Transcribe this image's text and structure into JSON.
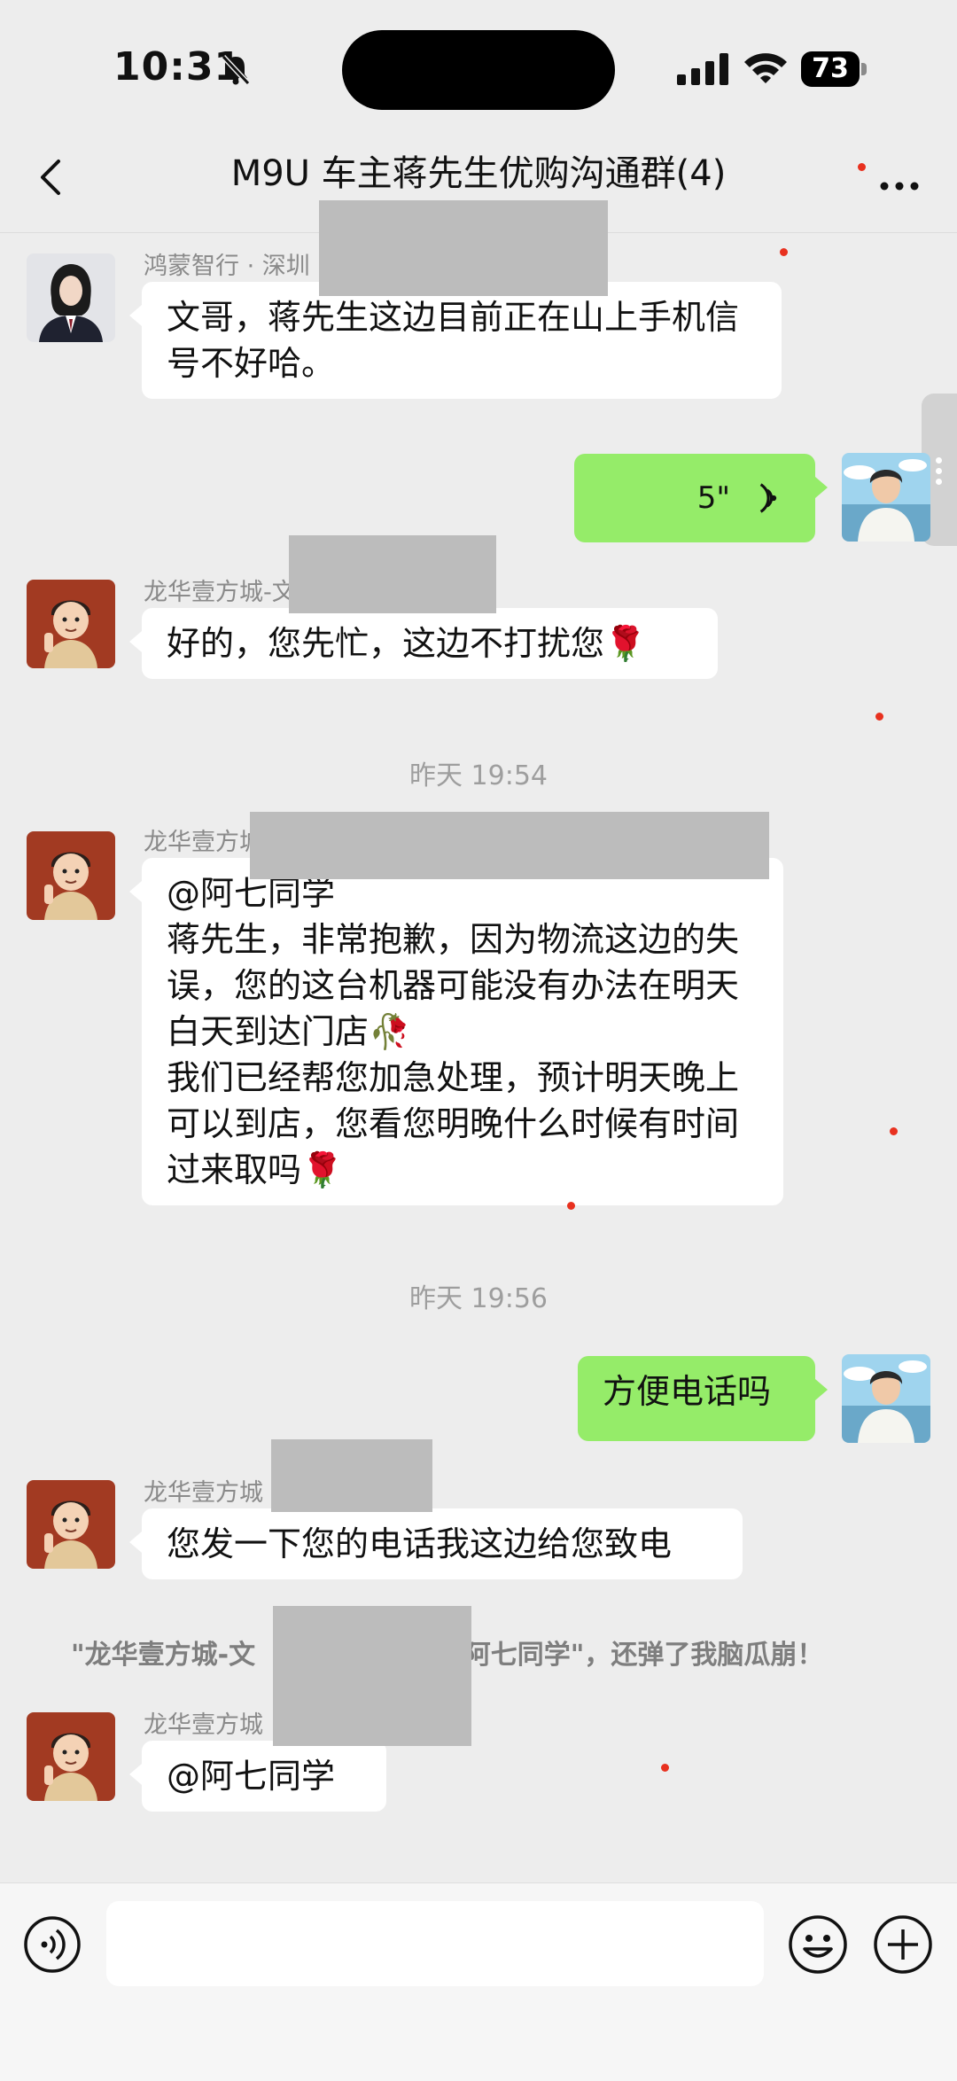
{
  "status_bar": {
    "time": "10:31",
    "battery": "73"
  },
  "nav": {
    "title": "M9U 车主蒋先生优购沟通群(4)"
  },
  "messages": [
    {
      "sender": "鸿蒙智行 · 深圳",
      "text": "文哥，蒋先生这边目前正在山上手机信号不好哈。"
    },
    {
      "voice_duration": "5\""
    },
    {
      "sender": "龙华壹方城-文",
      "text": "好的，您先忙，这边不打扰您🌹"
    },
    {
      "sender": "龙华壹方城",
      "mention": "@阿七同学",
      "text": "蒋先生，非常抱歉，因为物流这边的失误，您的这台机器可能没有办法在明天白天到达门店🥀",
      "text2": "我们已经帮您加急处理，预计明天晚上可以到店，您看您明晚什么时候有时间过来取吗🌹"
    },
    {
      "text": "方便电话吗"
    },
    {
      "sender": "龙华壹方城",
      "text": "您发一下您的电话我这边给您致电"
    },
    {
      "sender": "龙华壹方城",
      "text": "@阿七同学"
    }
  ],
  "time_separators": [
    "昨天 19:54",
    "昨天 19:56"
  ],
  "system_notice": {
    "part1": "\"龙华壹方城-文",
    "part2": "\"阿七同学\"，还弹了我脑瓜崩！"
  },
  "colors": {
    "background": "#ededed",
    "green_bubble": "#95ec69",
    "white_bubble": "#ffffff"
  },
  "icons": [
    "back-icon",
    "more-icon",
    "voice-icon",
    "emoji-icon",
    "plus-icon"
  ]
}
